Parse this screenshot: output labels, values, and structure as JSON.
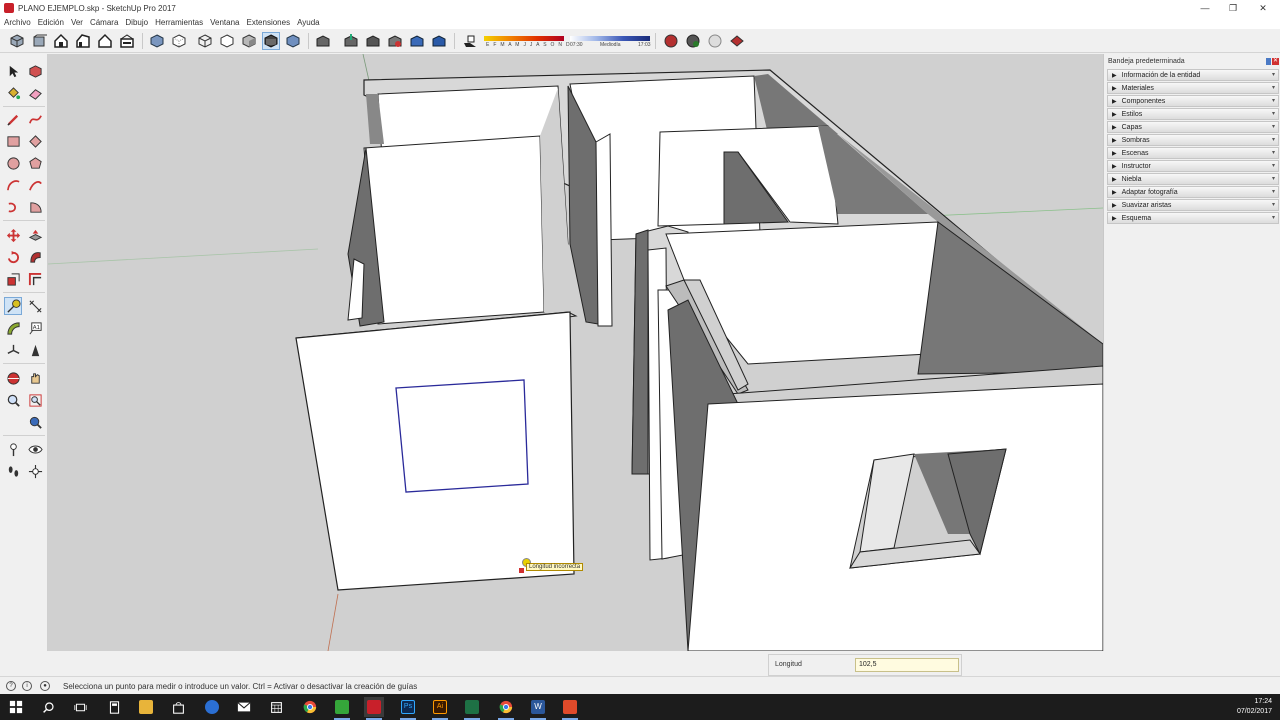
{
  "window": {
    "title": "PLANO EJEMPLO.skp - SketchUp Pro 2017",
    "controls": {
      "minimize": "—",
      "maximize": "❐",
      "close": "✕"
    }
  },
  "menu": [
    "Archivo",
    "Edición",
    "Ver",
    "Cámara",
    "Dibujo",
    "Herramientas",
    "Ventana",
    "Extensiones",
    "Ayuda"
  ],
  "shadow_settings": {
    "months": "E F M A M J J A S O N D",
    "time_start": "07:30",
    "time_mid": "Mediodía",
    "time_end": "17:03"
  },
  "tray": {
    "title": "Bandeja predeterminada",
    "items": [
      "Información de la entidad",
      "Materiales",
      "Componentes",
      "Estilos",
      "Capas",
      "Sombras",
      "Escenas",
      "Instructor",
      "Niebla",
      "Adaptar fotografía",
      "Suavizar aristas",
      "Esquema"
    ]
  },
  "viewport": {
    "tooltip": "Longitud incorrecta",
    "background_color": "#d0d0d0",
    "wall_color": "#ffffff",
    "shadow_color": "#737373",
    "selection_color": "#2a2a9a"
  },
  "measurement": {
    "label": "Longitud",
    "value": "102,5"
  },
  "status": {
    "text": "Selecciona un punto para medir o introduce un valor. Ctrl = Activar o desactivar la creación de guías"
  },
  "taskbar": {
    "time": "17:24",
    "date": "07/02/2017",
    "apps": [
      {
        "name": "file-explorer",
        "color": "#e8b43a"
      },
      {
        "name": "edge",
        "color": "#2b6fd3"
      },
      {
        "name": "mail",
        "color": "#ffffff"
      },
      {
        "name": "calendar",
        "color": "#ffffff"
      },
      {
        "name": "chrome",
        "color": "#e84b3a"
      },
      {
        "name": "camtasia",
        "color": "#35a63a"
      },
      {
        "name": "sketchup",
        "color": "#c8202a"
      },
      {
        "name": "photoshop",
        "color": "#0d2a52"
      },
      {
        "name": "illustrator",
        "color": "#3a1a00"
      },
      {
        "name": "chrome-2",
        "color": "#e84b3a"
      },
      {
        "name": "word",
        "color": "#2b579a"
      },
      {
        "name": "excel",
        "color": "#1e7145"
      },
      {
        "name": "camtasia-recorder",
        "color": "#e04a2a"
      }
    ]
  }
}
